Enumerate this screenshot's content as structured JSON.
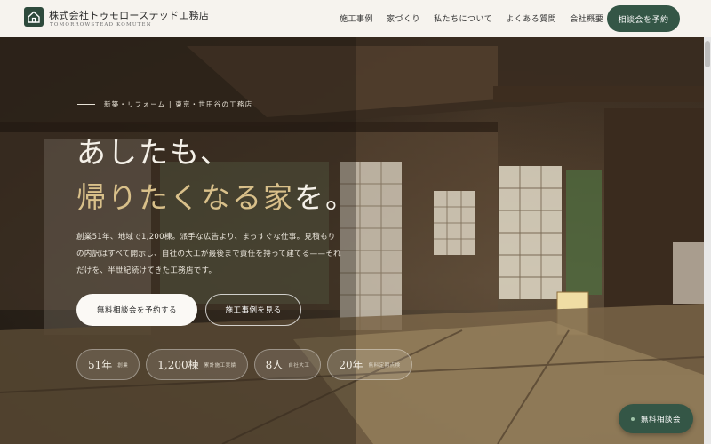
{
  "header": {
    "brand_name": "株式会社トゥモローステッド工務店",
    "brand_sub": "TOMORROWSTEAD KOMUTEN",
    "logo_icon": "house-icon",
    "nav": [
      "施工事例",
      "家づくり",
      "私たちについて",
      "よくある質問",
      "会社概要"
    ],
    "cta": "相談会を予約"
  },
  "hero": {
    "eyebrow": "新築・リフォーム | 東京・世田谷の工務店",
    "headline_1": "あしたも、",
    "headline_2_accent": "帰りたくなる家",
    "headline_2_rest": "を。",
    "lead": "創業51年、地域で1,200棟。派手な広告より、まっすぐな仕事。見積もりの内訳はすべて開示し、自社の大工が最後まで責任を持って建てる——それだけを、半世紀続けてきた工務店です。",
    "primary_button": "無料相談会を予約する",
    "secondary_button": "施工事例を見る",
    "stats": [
      {
        "num": "51年",
        "label": "創業"
      },
      {
        "num": "1,200棟",
        "label": "累計施工実績"
      },
      {
        "num": "8人",
        "label": "自社大工"
      },
      {
        "num": "20年",
        "label": "無料定期点検"
      }
    ]
  },
  "float_cta": "無料相談会",
  "colors": {
    "accent": "#345646",
    "gold": "#d9c08a",
    "header_bg": "#f6f3ee"
  }
}
